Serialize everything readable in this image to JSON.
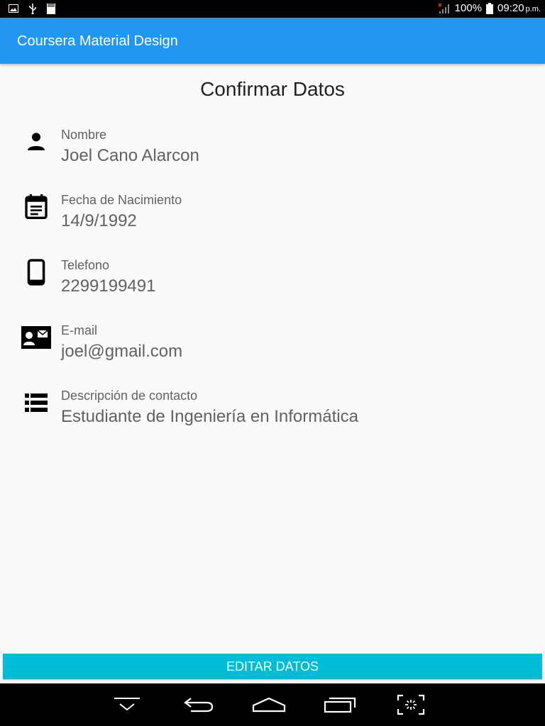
{
  "status_bar": {
    "battery": "100%",
    "time": "09:20",
    "ampm": "p.m.",
    "icons": [
      "image-icon",
      "usb-icon",
      "sd-card-icon",
      "signal-icon",
      "battery-icon"
    ]
  },
  "app_bar": {
    "title": "Coursera Material Design",
    "color": "#2196f3"
  },
  "page": {
    "title": "Confirmar Datos"
  },
  "fields": [
    {
      "icon": "person-icon",
      "label": "Nombre",
      "value": "Joel Cano Alarcon"
    },
    {
      "icon": "calendar-icon",
      "label": "Fecha de Nacimiento",
      "value": "14/9/1992"
    },
    {
      "icon": "phone-icon",
      "label": "Telefono",
      "value": "2299199491"
    },
    {
      "icon": "contact-mail-icon",
      "label": "E-mail",
      "value": "joel@gmail.com"
    },
    {
      "icon": "list-icon",
      "label": "Descripción de contacto",
      "value": "Estudiante de Ingeniería en Informática"
    }
  ],
  "actions": {
    "edit_label": "EDITAR DATOS",
    "color": "#00bcd4"
  },
  "nav_bar": {
    "icons": [
      "hide-keyboard-icon",
      "back-icon",
      "home-icon",
      "recents-icon",
      "screenshot-icon"
    ]
  }
}
